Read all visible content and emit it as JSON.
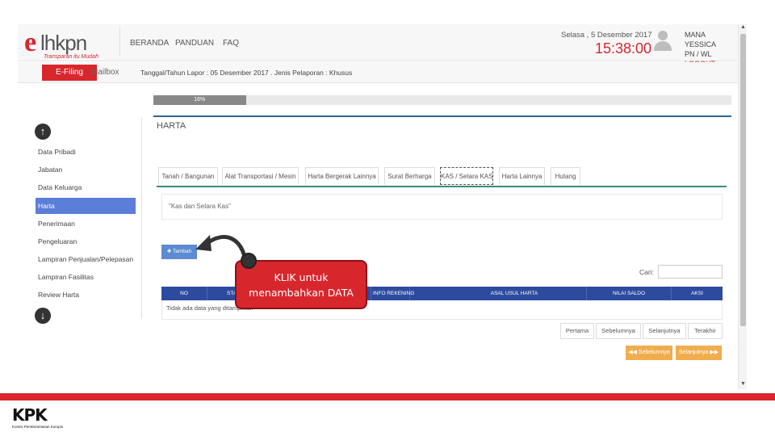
{
  "logo": {
    "e": "e",
    "rest": "lhkpn",
    "tagline": "Transparan itu Mudah"
  },
  "nav": {
    "beranda": "BERANDA",
    "panduan": "PANDUAN",
    "faq": "FAQ"
  },
  "header": {
    "date": "Selasa , 5 Desember 2017",
    "time": "15:38:00",
    "user_name": "MANA YESSICA",
    "user_role": "PN / WL",
    "logout": "LOGOUT"
  },
  "subnav": {
    "efiling": "E-Filing",
    "mailbox": "Mailbox",
    "jenis": "Tanggal/Tahun Lapor : 05 Desember 2017 . Jenis Pelaporan : Khusus"
  },
  "progress": {
    "label": "16%",
    "value": 0.16
  },
  "section": {
    "title": "HARTA"
  },
  "sidebar": {
    "items": [
      {
        "label": "Data Pribadi"
      },
      {
        "label": "Jabatan"
      },
      {
        "label": "Data Keluarga"
      },
      {
        "label": "Harta"
      },
      {
        "label": "Penerimaan"
      },
      {
        "label": "Pengeluaran"
      },
      {
        "label": "Lampiran Penjualan/Pelepasan"
      },
      {
        "label": "Lampiran Fasilitas"
      },
      {
        "label": "Review Harta"
      }
    ],
    "up_icon": "arrow-up-circle-icon",
    "down_icon": "arrow-down-circle-icon"
  },
  "tabs": [
    {
      "label": "Tanah / Bangunan"
    },
    {
      "label": "Alat Transportasi / Mesin"
    },
    {
      "label": "Harta Bergerak Lainnya"
    },
    {
      "label": "Surat Berharga"
    },
    {
      "label": "KAS / Setara KAS"
    },
    {
      "label": "Harta Lainnya"
    },
    {
      "label": "Hutang"
    }
  ],
  "panel": {
    "text": "\"Kas dan Setara Kas\""
  },
  "buttons": {
    "tambah": "✚ Tambah",
    "sebelumnya": "◀◀ Sebelumnya",
    "selanjutnya": "Selanjutnya ▶▶"
  },
  "search": {
    "label": "Cari:",
    "value": ""
  },
  "table": {
    "headers": [
      "NO",
      "STA",
      "",
      "INFO REKENING",
      "ASAL USUL HARTA",
      "NILAI SALDO",
      "AKSI"
    ],
    "empty_text": "Tidak ada data yang ditampilkan"
  },
  "pagination": {
    "first": "Pertama",
    "prev": "Sebelumnya",
    "next": "Selanjutnya",
    "last": "Terakhir"
  },
  "callout": {
    "line1": "KLIK untuk",
    "line2": "menambahkan DATA"
  },
  "footer": {
    "kpk": "KPK",
    "subtitle": "Komisi Pemberantasan Korupsi"
  },
  "colors": {
    "brand_red": "#d8262d",
    "header_blue": "#2d4b9e",
    "menu_active": "#5b7ed8",
    "orange": "#f0ad4e"
  }
}
